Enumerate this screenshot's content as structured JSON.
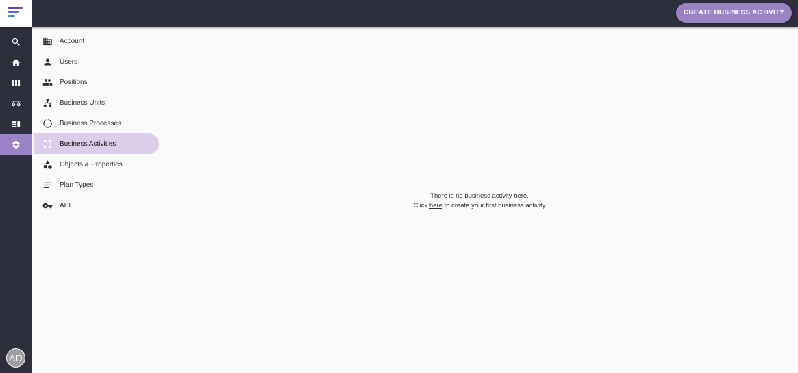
{
  "header": {
    "create_button_label": "CREATE BUSINESS ACTIVITY",
    "logo": "app-logo",
    "accent_color": "#9b82c4",
    "bar_color": "#2d2f3d"
  },
  "rail": {
    "items": [
      {
        "icon": "search-icon"
      },
      {
        "icon": "home-icon"
      },
      {
        "icon": "dashboard-icon"
      },
      {
        "icon": "scale-icon"
      },
      {
        "icon": "list-icon"
      },
      {
        "icon": "gear-icon",
        "active": true
      }
    ],
    "avatar_initials": "AD"
  },
  "settings_nav": {
    "items": [
      {
        "label": "Account",
        "icon": "building-icon"
      },
      {
        "label": "Users",
        "icon": "person-icon"
      },
      {
        "label": "Positions",
        "icon": "people-icon"
      },
      {
        "label": "Business Units",
        "icon": "hierarchy-icon"
      },
      {
        "label": "Business Processes",
        "icon": "cycle-icon"
      },
      {
        "label": "Business Activities",
        "icon": "flow-icon",
        "active": true
      },
      {
        "label": "Objects & Properties",
        "icon": "shapes-icon"
      },
      {
        "label": "Plan Types",
        "icon": "lines-icon"
      },
      {
        "label": "API",
        "icon": "key-icon"
      }
    ]
  },
  "empty_state": {
    "line1": "There is no business activity here.",
    "line2_prefix": "Click",
    "link_text": "here",
    "line2_suffix": "to create your first business activity"
  }
}
